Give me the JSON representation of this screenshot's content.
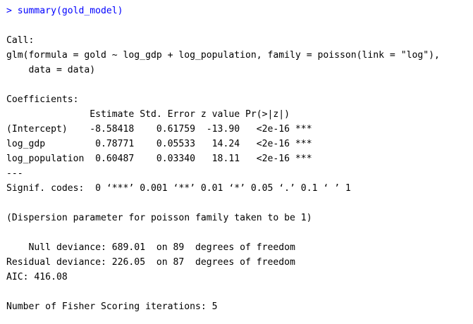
{
  "console": {
    "prompt_color": "#0000ff",
    "output_color": "#000000",
    "background": "#ffffff",
    "command": "> summary(gold_model)",
    "output": [
      "",
      "Call:",
      "glm(formula = gold ~ log_gdp + log_population, family = poisson(link = \"log\"),",
      "    data = data)",
      "",
      "Coefficients:",
      "               Estimate Std. Error z value Pr(>|z|)    ",
      "(Intercept)    -8.58418    0.61759  -13.90   <2e-16 ***",
      "log_gdp         0.78771    0.05533   14.24   <2e-16 ***",
      "log_population  0.60487    0.03340   18.11   <2e-16 ***",
      "---",
      "Signif. codes:  0 ‘***’ 0.001 ‘**’ 0.01 ‘*’ 0.05 ‘.’ 0.1 ‘ ’ 1",
      "",
      "(Dispersion parameter for poisson family taken to be 1)",
      "",
      "    Null deviance: 689.01  on 89  degrees of freedom",
      "Residual deviance: 226.05  on 87  degrees of freedom",
      "AIC: 416.08",
      "",
      "Number of Fisher Scoring iterations: 5"
    ]
  }
}
